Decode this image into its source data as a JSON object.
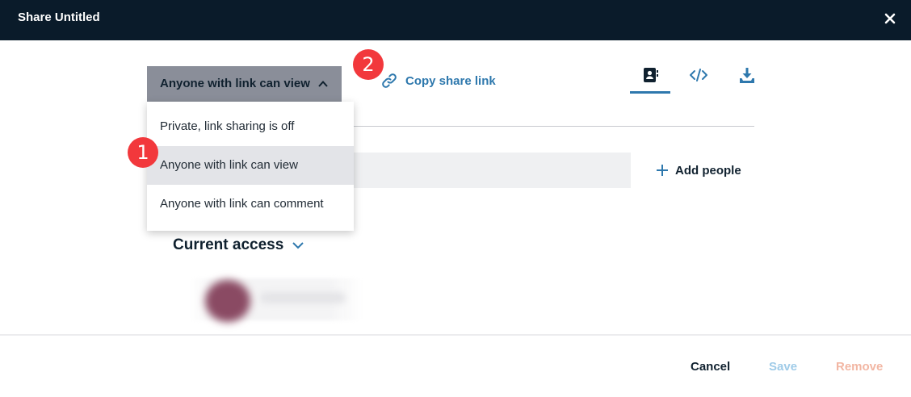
{
  "header": {
    "title": "Share Untitled"
  },
  "access_dropdown": {
    "selected": "Anyone with link can view"
  },
  "access_menu": {
    "options": [
      "Private, link sharing is off",
      "Anyone with link can view",
      "Anyone with link can comment"
    ],
    "selected_index": 1
  },
  "copy_link": {
    "label": "Copy share link"
  },
  "badges": [
    "1",
    "2"
  ],
  "tabs": [
    {
      "icon": "contact-book-icon",
      "active": true
    },
    {
      "icon": "code-icon",
      "active": false
    },
    {
      "icon": "download-icon",
      "active": false
    }
  ],
  "add_people": {
    "label": "Add people"
  },
  "current_access": {
    "label": "Current access"
  },
  "footer": {
    "cancel": "Cancel",
    "save": "Save",
    "remove": "Remove"
  },
  "colors": {
    "header_bg": "#0a1b2a",
    "accent": "#2e78ad",
    "badge": "#f2383c",
    "save_disabled": "#9fcbe8",
    "remove_disabled": "#f2b6a3"
  }
}
